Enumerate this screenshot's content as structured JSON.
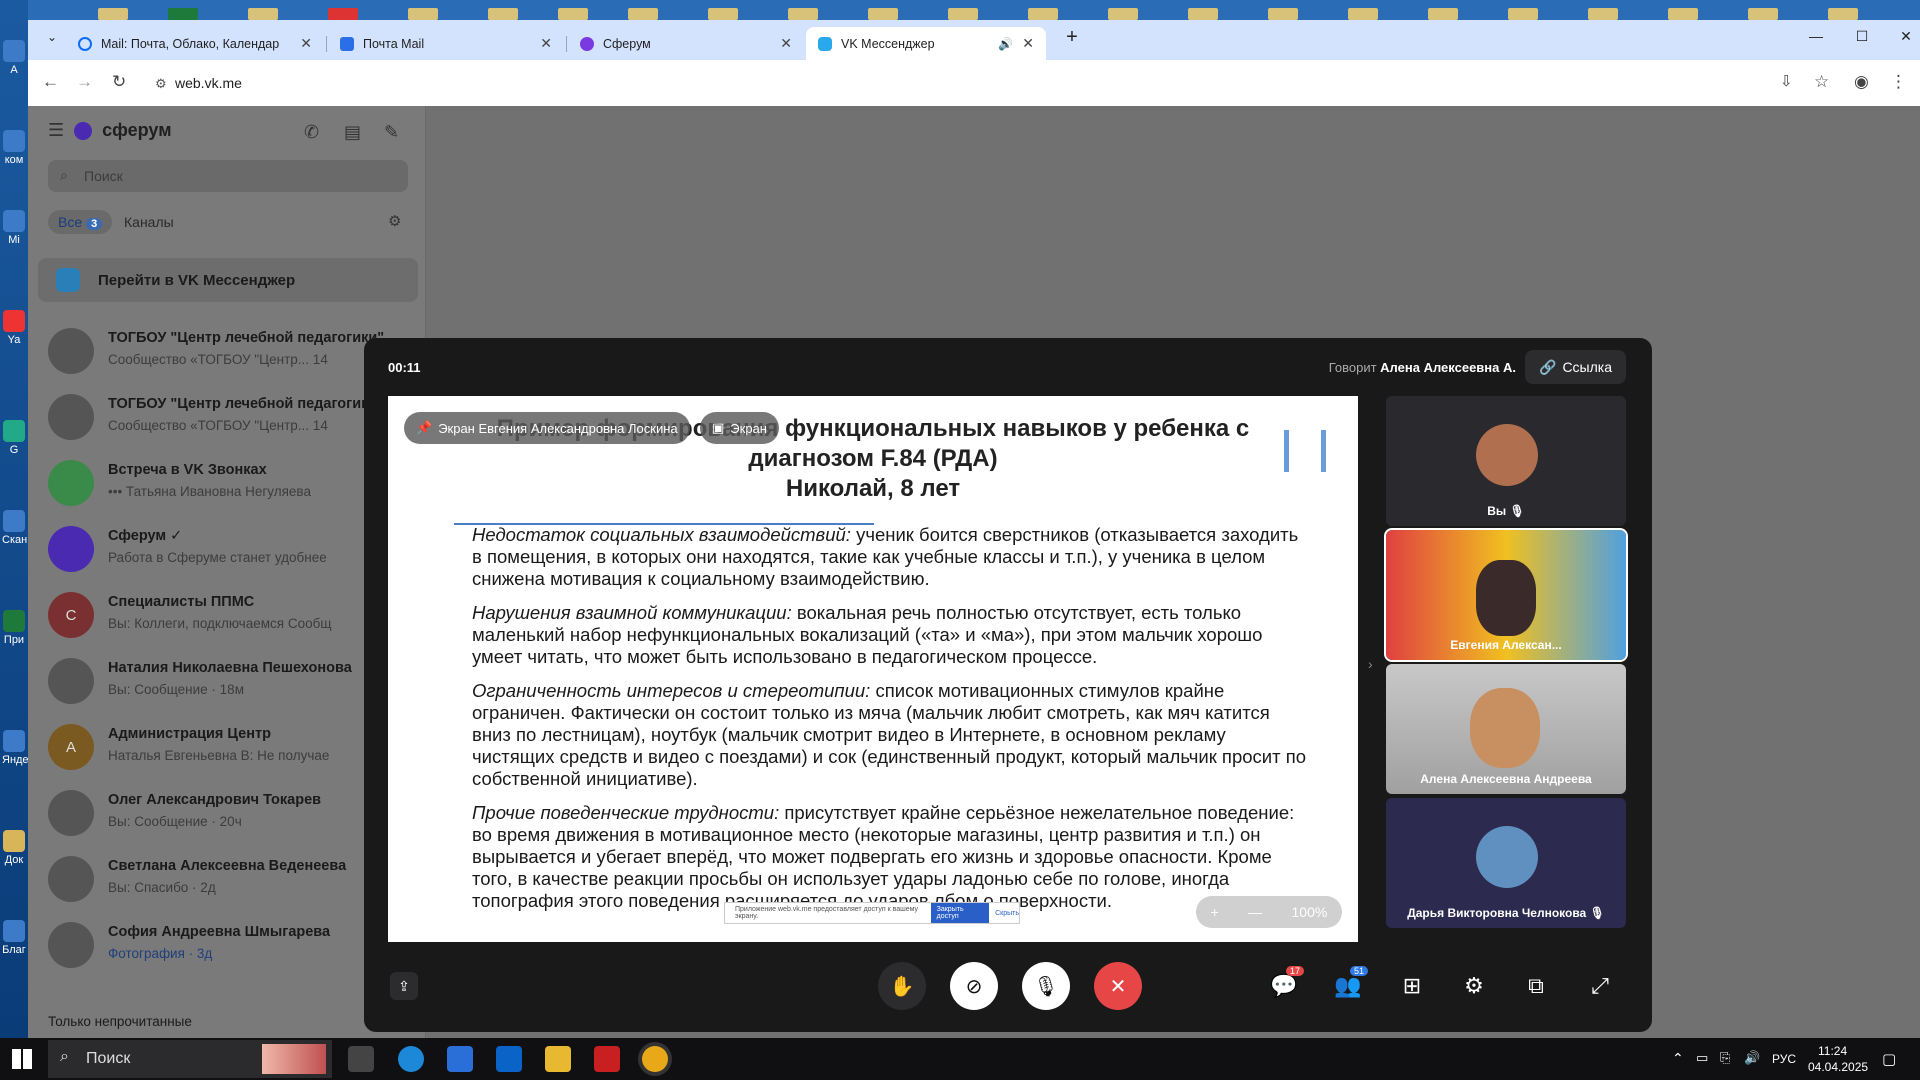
{
  "browser": {
    "tabs": [
      {
        "label": "Mail: Почта, Облако, Календар",
        "color": "#0a6cff"
      },
      {
        "label": "Почта Mail",
        "color": "#2a6fe8"
      },
      {
        "label": "Сферум",
        "color": "#7a3ae0"
      },
      {
        "label": "VK Мессенджер",
        "color": "#29a9eb"
      }
    ],
    "url": "web.vk.me"
  },
  "sidebar": {
    "brand": "сферум",
    "search_placeholder": "Поиск",
    "filter_all": "Все",
    "filter_all_count": "3",
    "filter_channels": "Каналы",
    "goto": "Перейти в VK Мессенджер",
    "chats": [
      {
        "name": "ТОГБОУ \"Центр лечебной педагогики\"",
        "preview": "Сообщество «ТОГБОУ \"Центр... 14",
        "avatar": ""
      },
      {
        "name": "ТОГБОУ \"Центр лечебной педагогики\"",
        "preview": "Сообщество «ТОГБОУ \"Центр... 14",
        "avatar": ""
      },
      {
        "name": "Встреча в VK Звонках",
        "preview": "••• Татьяна Ивановна Негуляева",
        "avatar": ""
      },
      {
        "name": "Сферум ✓",
        "preview": "Работа в Сферуме станет удобнее",
        "avatar": ""
      },
      {
        "name": "Специалисты ППМС",
        "preview": "Вы: Коллеги, подключаемся Сообщ",
        "avatar": "С"
      },
      {
        "name": "Наталия Николаевна Пешехонова",
        "preview": "Вы: Сообщение · 18м",
        "avatar": ""
      },
      {
        "name": "Администрация Центр",
        "preview": "Наталья Евгеньевна В: Не получае",
        "avatar": "А"
      },
      {
        "name": "Олег Александрович Токарев",
        "preview": "Вы: Сообщение · 20ч",
        "avatar": ""
      },
      {
        "name": "Светлана Алексеевна Веденеева",
        "preview": "Вы: Спасибо · 2д",
        "avatar": ""
      },
      {
        "name": "София Андреевна Шмыгарева",
        "preview": "Фотография · 3д",
        "avatar": ""
      }
    ],
    "unread_only": "Только непрочитанные"
  },
  "call": {
    "timer": "00:11",
    "speaking_label": "Говорит",
    "speaker": "Алена Алексеевна А.",
    "link_label": "Ссылка",
    "overlay_screen_owner": "Экран Евгения Александровна Лоскина",
    "overlay_screen": "Экран",
    "zoom": "100%",
    "share_notice": "Приложение web.vk.me предоставляет доступ к вашему экрану.",
    "share_stop": "Закрыть доступ",
    "share_hide": "Скрыть",
    "slide": {
      "title_l1": "Пример формирования функциональных навыков у ребенка с",
      "title_l2": "диагнозом F.84 (РДА)",
      "title_l3": "Николай, 8 лет",
      "p1_head": "Недостаток социальных взаимодействий:",
      "p1_text": " ученик боится сверстников (отказывается заходить в помещения, в которых они находятся, такие как учебные классы и т.п.), у ученика в целом снижена мотивация к социальному взаимодействию.",
      "p2_head": "Нарушения взаимной коммуникации:",
      "p2_text": " вокальная речь полностью отсутствует, есть только маленький набор нефункциональных вокализаций («та» и «ма»), при этом мальчик хорошо умеет читать, что может быть использовано в педагогическом процессе.",
      "p3_head": "Ограниченность интересов и стереотипии:",
      "p3_text": " список мотивационных стимулов крайне ограничен. Фактически он состоит только из мяча (мальчик любит смотреть, как мяч катится вниз по лестницам), ноутбук (мальчик смотрит видео в Интернете, в основном рекламу чистящих средств и видео с поездами) и сок (единственный продукт, который мальчик просит по собственной инициативе).",
      "p4_head": "Прочие поведенческие трудности:",
      "p4_text": " присутствует крайне серьёзное нежелательное поведение: во время движения в мотивационное место (некоторые магазины, центр развития и т.п.) он вырывается и убегает вперёд, что может подвергать его жизнь и здоровье опасности. Кроме того, в качестве реакции просьбы он использует удары ладонью себе по голове, иногда топография этого поведения расширяется до ударов лбом о поверхности."
    },
    "participants": [
      {
        "name": "Вы"
      },
      {
        "name": "Евгения Алексан..."
      },
      {
        "name": "Алена Алексеевна Андреева"
      },
      {
        "name": "Дарья Викторовна Челнокова"
      }
    ],
    "chat_badge": "17",
    "people_badge": "51"
  },
  "taskbar": {
    "search": "Поиск",
    "lang": "РУС",
    "time": "11:24",
    "date": "04.04.2025"
  }
}
